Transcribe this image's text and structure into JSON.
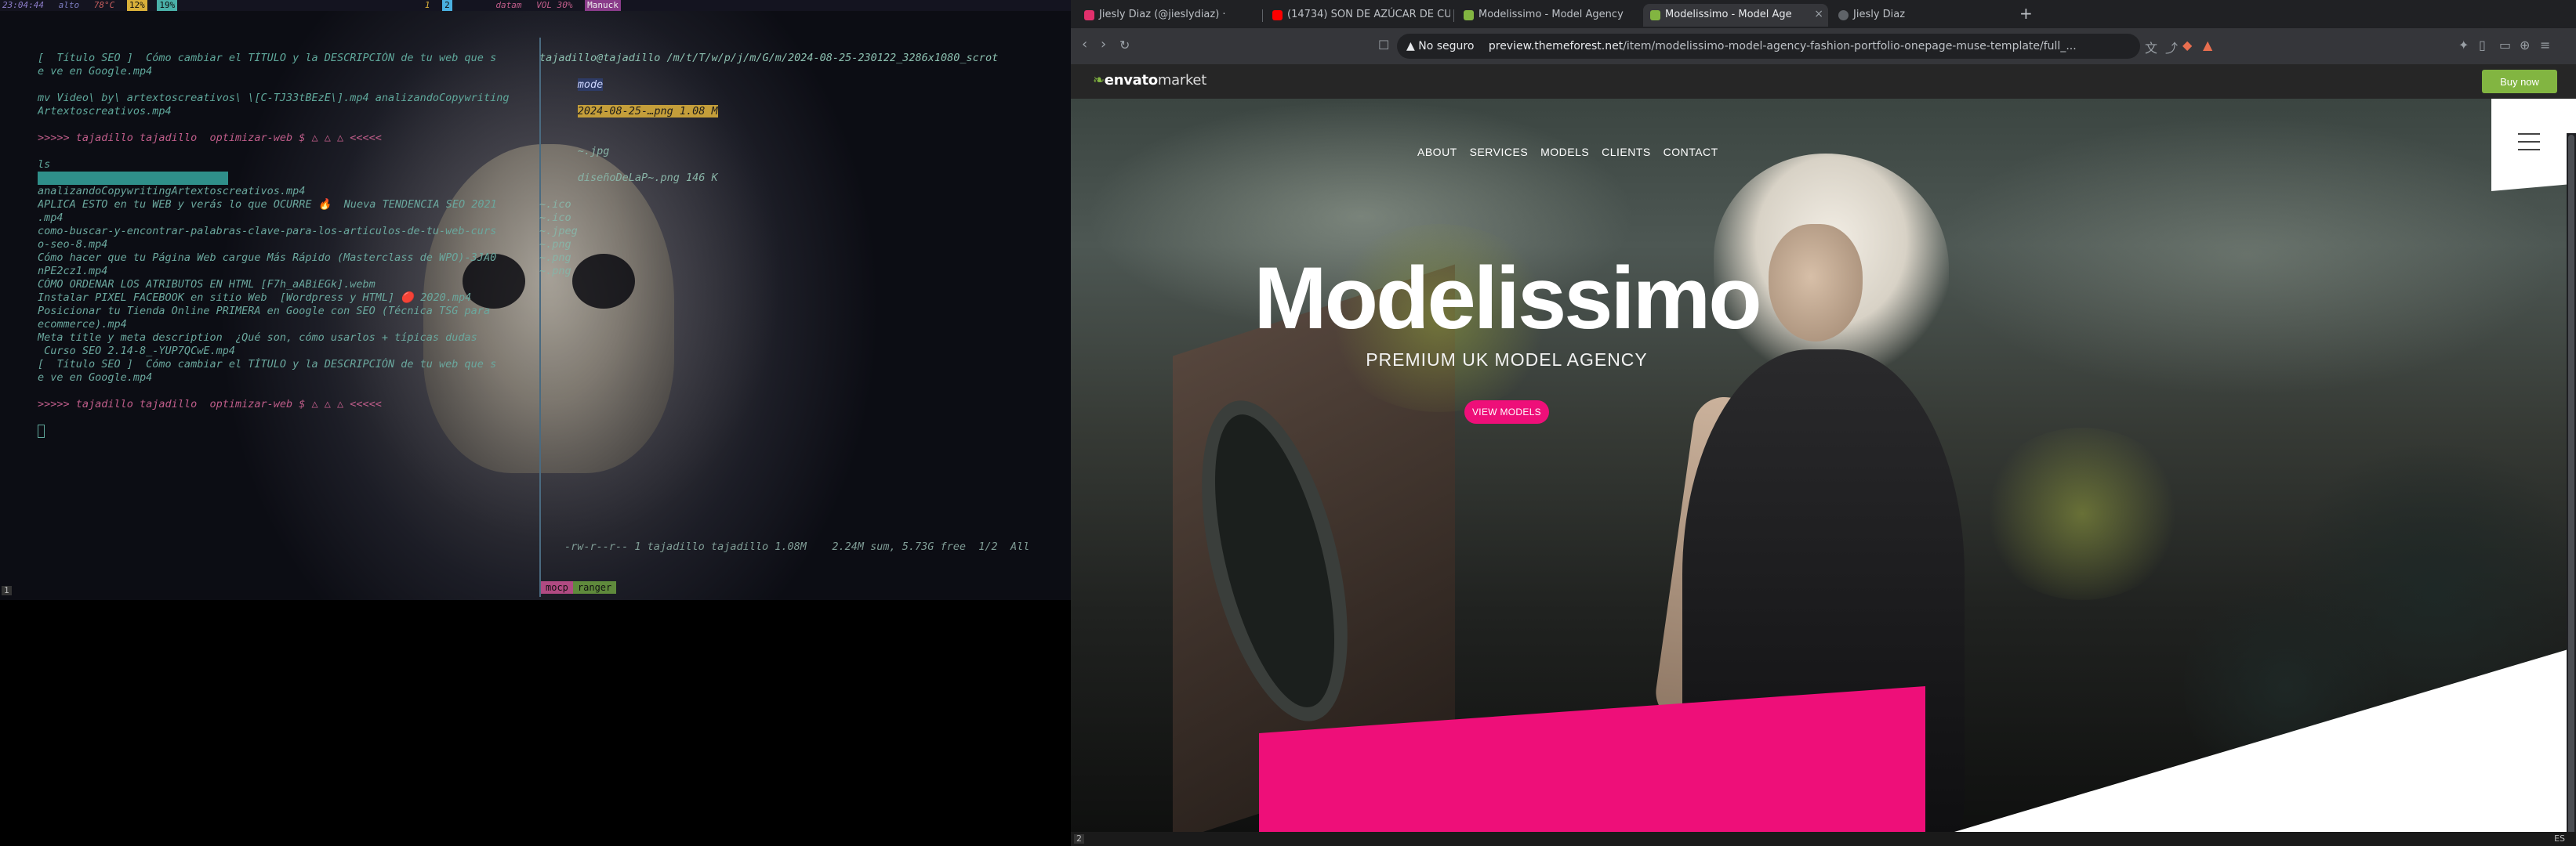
{
  "statusbar": {
    "time": "23:04:44",
    "items": [
      "alto",
      "78°C",
      "12%",
      "19%",
      "datam",
      "VOL 30%",
      "Manuck"
    ],
    "ws_left": "1",
    "ws_active": "2"
  },
  "terminal": {
    "left_lines": [
      "[  Título SEO ]  Cómo cambiar el TÍTULO y la DESCRIPCIÓN de tu web que s",
      "e ve en Google.mp4",
      "",
      "mv Video\\ by\\ artextoscreativos\\ \\[C-TJ33tBEzE\\].mp4 analizandoCopywriting",
      "Artextoscreativos.mp4",
      "",
      ">>>>> tajadillo tajadillo  optimizar-web $ △ △ △ <<<<<",
      "",
      "ls",
      "",
      "analizandoCopywritingArtextoscreativos.mp4",
      "APLICA ESTO en tu WEB y verás lo que OCURRE 🔥  Nueva TENDENCIA SEO 2021",
      ".mp4",
      "como-buscar-y-encontrar-palabras-clave-para-los-articulos-de-tu-web-curs",
      "o-seo-8.mp4",
      "Cómo hacer que tu Página Web cargue Más Rápido (Masterclass de WPO)-3JA0",
      "nPE2cz1.mp4",
      "CÓMO ORDENAR LOS ATRIBUTOS EN HTML [F7h_aABiEGk].webm",
      "Instalar PIXEL FACEBOOK en sitio Web  [Wordpress y HTML] 🔴 2020.mp4",
      "Posicionar tu Tienda Online PRIMERA en Google con SEO (Técnica TSG para",
      "ecommerce).mp4",
      "Meta title y meta description  ¿Qué son, cómo usarlos + típicas dudas",
      " Curso SEO 2.14-8_-YUP7QCwE.mp4",
      "[  Título SEO ]  Cómo cambiar el TÍTULO y la DESCRIPCIÓN de tu web que s",
      "e ve en Google.mp4",
      "",
      ">>>>> tajadillo tajadillo  optimizar-web $ △ △ △ <<<<<"
    ],
    "prompt_first": ">>>>> tajadillo tajadillo  optimizar-web $ △ △ △ <<<<<",
    "ranger_header": "tajadillo@tajadillo /m/t/T/w/p/j/m/G/m/2024-08-25-230122_3286x1080_scrot",
    "ranger_dir": "mode",
    "ranger_preview": "2024-08-25-…png 1.08 M",
    "ranger_entries": [
      "~.jpg",
      "~.ico",
      "~.ico",
      "~.jpeg",
      "~.png",
      "~.png",
      "~.png"
    ],
    "ranger_preview_second": "diseñoDeLaP~.png 146 K",
    "ranger_status": "-rw-r--r-- 1 tajadillo tajadillo 1.08M    2.24M sum, 5.73G free  1/2  All",
    "tab_mocp": "mocp",
    "tab_ranger": "ranger",
    "ws_bottom": "1"
  },
  "browser": {
    "tabs": [
      {
        "label": "Jiesly Diaz (@jieslydiaz) · ",
        "color": "#e1306c"
      },
      {
        "label": "(14734) SON DE AZÚCAR DE CU",
        "color": "#ff0000"
      },
      {
        "label": "Modelissimo - Model Agency",
        "color": "#82b541"
      },
      {
        "label": "Modelissimo - Model Age",
        "color": "#82b541"
      },
      {
        "label": "Jiesly Diaz",
        "color": "#9aa0a6"
      }
    ],
    "close_glyph": "×",
    "new_tab": "+",
    "not_secure": "No seguro",
    "url_host": "preview.themeforest.net",
    "url_path": "/item/modelissimo-model-agency-fashion-portfolio-onepage-muse-template/full_...",
    "envato_logo": "envato",
    "envato_market": "market",
    "buy_now": "Buy now",
    "nav": [
      "ABOUT",
      "SERVICES",
      "MODELS",
      "CLIENTS",
      "CONTACT"
    ],
    "hero_title": "Modelissimo",
    "hero_subtitle": "PREMIUM UK MODEL AGENCY",
    "cta": "VIEW MODELS",
    "colors": {
      "pink": "#ee0f79",
      "envato_green": "#82b541"
    },
    "ws_bottom": "2",
    "tray_text": "ES"
  }
}
